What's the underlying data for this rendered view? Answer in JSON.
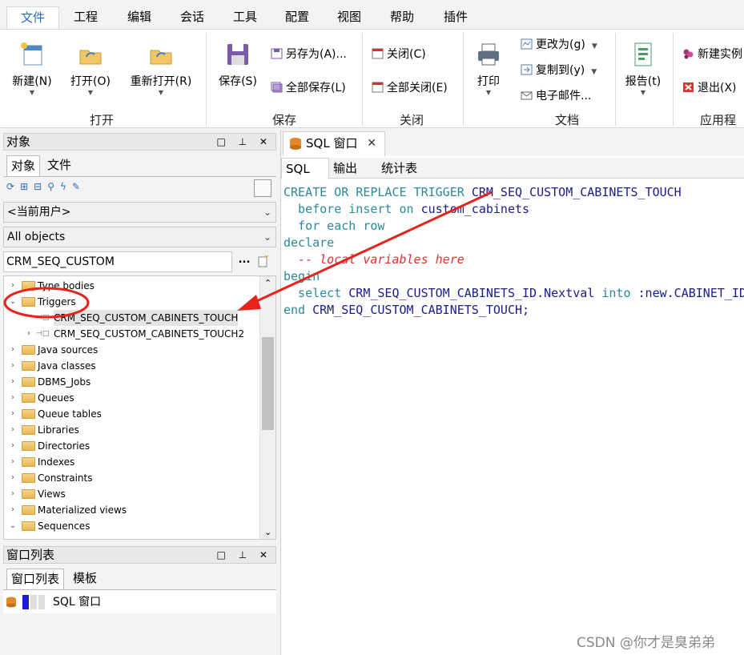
{
  "menu": {
    "tabs": [
      "文件",
      "工程",
      "编辑",
      "会话",
      "工具",
      "配置",
      "视图",
      "帮助",
      "插件"
    ],
    "active": "文件"
  },
  "ribbon": {
    "groups": {
      "open": "打开",
      "save": "保存",
      "close": "关闭",
      "document": "文档",
      "app": "应用程序"
    },
    "buttons": {
      "new": "新建(N)",
      "open": "打开(O)",
      "reopen": "重新打开(R)",
      "save": "保存(S)",
      "save_as": "另存为(A)...",
      "save_all": "全部保存(L)",
      "close": "关闭(C)",
      "close_all": "全部关闭(E)",
      "print": "打印",
      "change_to": "更改为(g)",
      "copy_to": "复制到(y)",
      "email": "电子邮件...",
      "report": "报告(t)",
      "new_instance": "新建实例",
      "exit": "退出(X)"
    }
  },
  "object_panel": {
    "title": "对象",
    "tabs": [
      "对象",
      "文件"
    ],
    "user_combo": "<当前用户>",
    "type_combo": "All objects",
    "search_value": "CRM_SEQ_CUSTOM",
    "search_btn": "...",
    "tree": [
      {
        "label": "Type bodies",
        "expander": "›",
        "kind": "folder"
      },
      {
        "label": "Triggers",
        "expander": "⌄",
        "kind": "folder"
      },
      {
        "label": "CRM_SEQ_CUSTOM_CABINETS_TOUCH",
        "expander": "",
        "kind": "trigger",
        "selected": true
      },
      {
        "label": "CRM_SEQ_CUSTOM_CABINETS_TOUCH2",
        "expander": "›",
        "kind": "trigger"
      },
      {
        "label": "Java sources",
        "expander": "›",
        "kind": "folder"
      },
      {
        "label": "Java classes",
        "expander": "›",
        "kind": "folder"
      },
      {
        "label": "DBMS_Jobs",
        "expander": "›",
        "kind": "folder"
      },
      {
        "label": "Queues",
        "expander": "›",
        "kind": "folder"
      },
      {
        "label": "Queue tables",
        "expander": "›",
        "kind": "folder"
      },
      {
        "label": "Libraries",
        "expander": "›",
        "kind": "folder"
      },
      {
        "label": "Directories",
        "expander": "›",
        "kind": "folder"
      },
      {
        "label": "Indexes",
        "expander": "›",
        "kind": "folder"
      },
      {
        "label": "Constraints",
        "expander": "›",
        "kind": "folder"
      },
      {
        "label": "Views",
        "expander": "›",
        "kind": "folder"
      },
      {
        "label": "Materialized views",
        "expander": "›",
        "kind": "folder"
      },
      {
        "label": "Sequences",
        "expander": "⌄",
        "kind": "folder"
      }
    ]
  },
  "window_panel": {
    "title": "窗口列表",
    "tabs": [
      "窗口列表",
      "模板"
    ],
    "items": [
      "SQL 窗口"
    ]
  },
  "document": {
    "tab_title": "SQL 窗口",
    "close_glyph": "✕",
    "subtabs": [
      "SQL",
      "输出",
      "统计表"
    ],
    "active_subtab": "SQL",
    "code_lines": [
      [
        {
          "t": "CREATE OR REPLACE TRIGGER ",
          "c": "kw"
        },
        {
          "t": "CRM_SEQ_CUSTOM_CABINETS_TOUCH",
          "c": "id"
        }
      ],
      [
        {
          "t": "  before insert on ",
          "c": "kw"
        },
        {
          "t": "custom_cabinets",
          "c": "id"
        }
      ],
      [
        {
          "t": "  for each row",
          "c": "kw"
        }
      ],
      [
        {
          "t": "declare",
          "c": "kw"
        }
      ],
      [
        {
          "t": "  -- local variables here",
          "c": "cm"
        }
      ],
      [
        {
          "t": "begin",
          "c": "kw"
        }
      ],
      [
        {
          "t": "  select ",
          "c": "kw"
        },
        {
          "t": "CRM_SEQ_CUSTOM_CABINETS_ID.Nextval ",
          "c": "id"
        },
        {
          "t": "into ",
          "c": "kw"
        },
        {
          "t": ":new.CABINET_ID ",
          "c": "id"
        }
      ],
      [
        {
          "t": "end ",
          "c": "kw"
        },
        {
          "t": "CRM_SEQ_CUSTOM_CABINETS_TOUCH;",
          "c": "id"
        }
      ]
    ]
  },
  "watermark": "CSDN @你才是臭弟弟",
  "colors": {
    "annotation": "#e8231b",
    "keyword": "#2a8a99",
    "identifier": "#1b1b8a",
    "comment": "#e03030",
    "active_menu": "#2a6bbf"
  }
}
